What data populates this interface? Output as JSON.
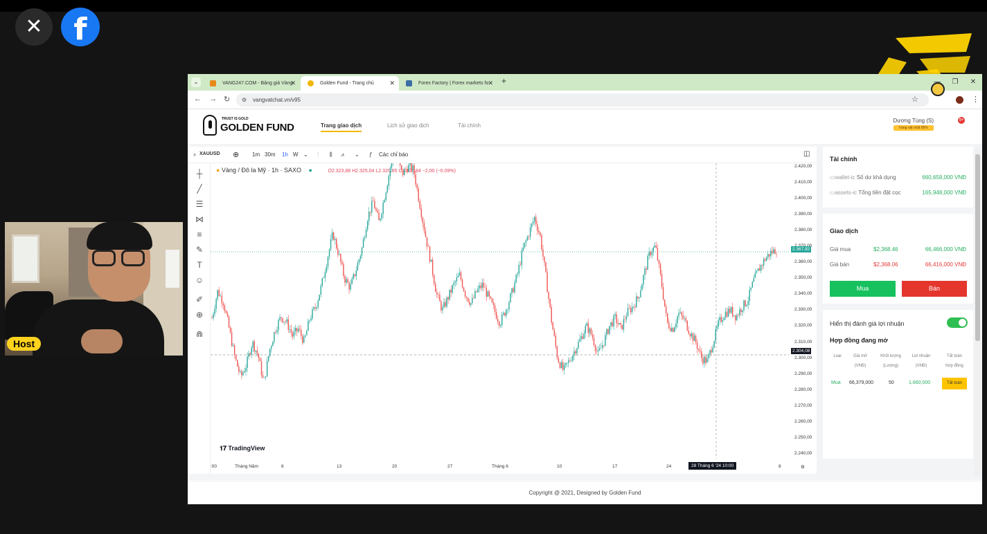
{
  "stream": {
    "host_label": "Host"
  },
  "browser": {
    "tabs": [
      {
        "title": "VANG247.COM - Bảng giá Vàng",
        "icon_color": "#e8891b"
      },
      {
        "title": "Golden Fund - Trang chủ",
        "icon_color": "#f2b705"
      },
      {
        "title": "Forex Factory | Forex markets fo",
        "icon_color": "#3a6ea5"
      }
    ],
    "url": "vangvatchat.vn/v95"
  },
  "site": {
    "brand_tagline": "TRUST IS GOLD",
    "brand_name": "GOLDEN FUND",
    "nav": [
      "Trang giao dịch",
      "Lịch sử giao dịch",
      "Tài chính"
    ],
    "user_name": "Dương Tùng (S)",
    "user_tag": "Vàng vật chất 95%",
    "notif_count": "9+",
    "footer": "Copyright @ 2021, Designed by Golden Fund"
  },
  "chart_toolbar": {
    "symbol": "XAUUSD",
    "intervals": [
      "1m",
      "30m",
      "1h",
      "W"
    ],
    "active_interval": "1h",
    "indicators": "Các chỉ báo"
  },
  "chart_data": {
    "type": "line",
    "symbol_label": "Vàng / Đô la Mỹ · 1h · SAXO",
    "ohlc_text": "O2.323,88 H2.325,04 L2.320,85 C2.321,84 −2,00 (−0.09%)",
    "ylim": [
      2237,
      2422
    ],
    "yticks": [
      "2.420,00",
      "2.410,00",
      "2.400,00",
      "2.390,00",
      "2.380,00",
      "2.370,00",
      "2.360,00",
      "2.350,00",
      "2.340,00",
      "2.330,00",
      "2.320,00",
      "2.310,00",
      "2.300,00",
      "2.290,00",
      "2.280,00",
      "2.270,00",
      "2.260,00",
      "2.250,00",
      "2.240,00"
    ],
    "xticks": [
      ":00",
      "Tháng Năm",
      "6",
      "13",
      "20",
      "27",
      "Tháng 6",
      "10",
      "17",
      "24",
      "8"
    ],
    "crosshair_label": "28 Tháng 6 '24   10:00",
    "last_price_tag": "2.367,82",
    "crosshair_price_tag": "2.304,08",
    "series": [
      {
        "values": [
          2325,
          2342,
          2335,
          2318,
          2300,
          2288,
          2296,
          2310,
          2302,
          2284,
          2305,
          2318,
          2326,
          2322,
          2314,
          2318,
          2310,
          2325,
          2332,
          2345,
          2362,
          2378,
          2365,
          2350,
          2344,
          2355,
          2368,
          2388,
          2398,
          2385,
          2402,
          2420,
          2428,
          2415,
          2420,
          2418,
          2398,
          2378,
          2360,
          2340,
          2330,
          2338,
          2346,
          2352,
          2340,
          2334,
          2342,
          2346,
          2338,
          2330,
          2322,
          2330,
          2340,
          2352,
          2368,
          2378,
          2388,
          2376,
          2350,
          2322,
          2300,
          2292,
          2298,
          2305,
          2312,
          2320,
          2314,
          2302,
          2310,
          2320,
          2325,
          2318,
          2328,
          2332,
          2338,
          2352,
          2366,
          2370,
          2348,
          2322,
          2318,
          2328,
          2324,
          2316,
          2310,
          2300,
          2298,
          2310,
          2322,
          2328,
          2330,
          2326,
          2332,
          2336,
          2348,
          2356,
          2362,
          2366,
          2368
        ]
      }
    ]
  },
  "finance": {
    "title": "Tài chính",
    "rows": [
      {
        "icon_alt": "wallet-ic",
        "label": "Số dư khả dụng",
        "value": "660,658,000 VNĐ"
      },
      {
        "icon_alt": "assets-ic",
        "label": "Tổng tiền đặt cọc",
        "value": "165,948,000 VNĐ"
      }
    ]
  },
  "trade": {
    "title": "Giao dịch",
    "buy_label": "Giá mua",
    "buy_usd": "$2,368.46",
    "buy_vnd": "66,466,000 VNĐ",
    "sell_label": "Giá bán",
    "sell_usd": "$2,368.06",
    "sell_vnd": "66,416,000 VNĐ",
    "buy_button": "Mua",
    "sell_button": "Bán"
  },
  "contracts": {
    "toggle_label": "Hiển thị đánh giá lợi nhuận",
    "title": "Hợp đồng đang mở",
    "headers": [
      "Loại",
      "Giá mở\n(VNĐ)",
      "Khối lượng\n(Lượng)",
      "Lợi nhuận\n(VNĐ)",
      "Tất toán\nhợp đồng"
    ],
    "row": {
      "type": "Mua",
      "open": "66,379,000",
      "qty": "50",
      "profit": "1,660,000",
      "action": "Tất toán"
    }
  }
}
